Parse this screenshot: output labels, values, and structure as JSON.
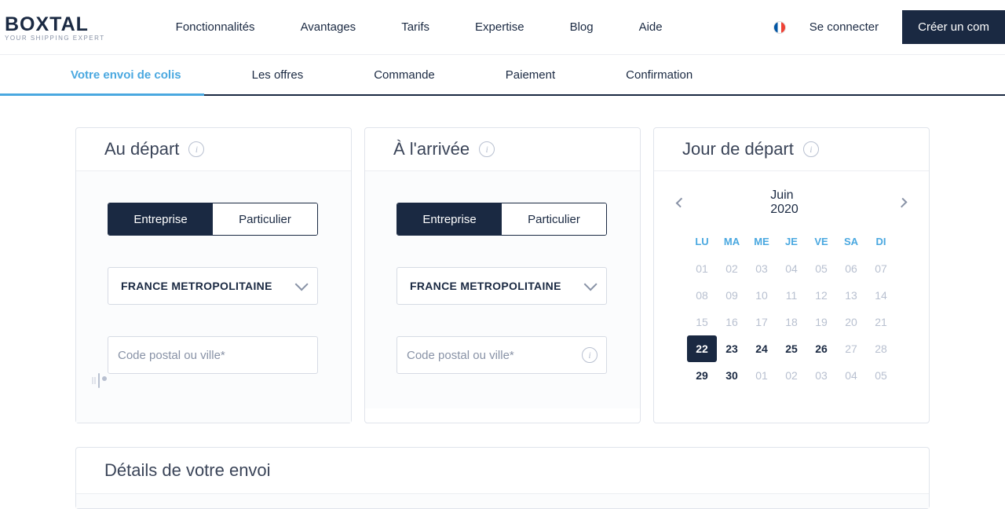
{
  "brand": {
    "name": "BOXTAL",
    "tagline": "YOUR SHIPPING EXPERT"
  },
  "nav": {
    "links": [
      "Fonctionnalités",
      "Avantages",
      "Tarifs",
      "Expertise",
      "Blog",
      "Aide"
    ],
    "login": "Se connecter",
    "cta": "Créer un com"
  },
  "steps": [
    "Votre envoi de colis",
    "Les offres",
    "Commande",
    "Paiement",
    "Confirmation"
  ],
  "depart": {
    "title": "Au départ",
    "entreprise": "Entreprise",
    "particulier": "Particulier",
    "country": "FRANCE METROPOLITAINE",
    "placeholder": "Code postal ou ville*"
  },
  "arrivee": {
    "title": "À l'arrivée",
    "entreprise": "Entreprise",
    "particulier": "Particulier",
    "country": "FRANCE METROPOLITAINE",
    "placeholder": "Code postal ou ville*"
  },
  "calendar": {
    "title": "Jour de départ",
    "month": "Juin 2020",
    "dow": [
      "LU",
      "MA",
      "ME",
      "JE",
      "VE",
      "SA",
      "DI"
    ],
    "days": [
      {
        "n": "01",
        "s": "dim"
      },
      {
        "n": "02",
        "s": "dim"
      },
      {
        "n": "03",
        "s": "dim"
      },
      {
        "n": "04",
        "s": "dim"
      },
      {
        "n": "05",
        "s": "dim"
      },
      {
        "n": "06",
        "s": "dim"
      },
      {
        "n": "07",
        "s": "dim"
      },
      {
        "n": "08",
        "s": "dim"
      },
      {
        "n": "09",
        "s": "dim"
      },
      {
        "n": "10",
        "s": "dim"
      },
      {
        "n": "11",
        "s": "dim"
      },
      {
        "n": "12",
        "s": "dim"
      },
      {
        "n": "13",
        "s": "dim"
      },
      {
        "n": "14",
        "s": "dim"
      },
      {
        "n": "15",
        "s": "dim"
      },
      {
        "n": "16",
        "s": "dim"
      },
      {
        "n": "17",
        "s": "dim"
      },
      {
        "n": "18",
        "s": "dim"
      },
      {
        "n": "19",
        "s": "dim"
      },
      {
        "n": "20",
        "s": "dim"
      },
      {
        "n": "21",
        "s": "dim"
      },
      {
        "n": "22",
        "s": "sel"
      },
      {
        "n": "23",
        "s": "av"
      },
      {
        "n": "24",
        "s": "av"
      },
      {
        "n": "25",
        "s": "av"
      },
      {
        "n": "26",
        "s": "av"
      },
      {
        "n": "27",
        "s": "dim"
      },
      {
        "n": "28",
        "s": "dim"
      },
      {
        "n": "29",
        "s": "av"
      },
      {
        "n": "30",
        "s": "av"
      },
      {
        "n": "01",
        "s": "dim"
      },
      {
        "n": "02",
        "s": "dim"
      },
      {
        "n": "03",
        "s": "dim"
      },
      {
        "n": "04",
        "s": "dim"
      },
      {
        "n": "05",
        "s": "dim"
      }
    ]
  },
  "details": {
    "title": "Détails de votre envoi"
  }
}
